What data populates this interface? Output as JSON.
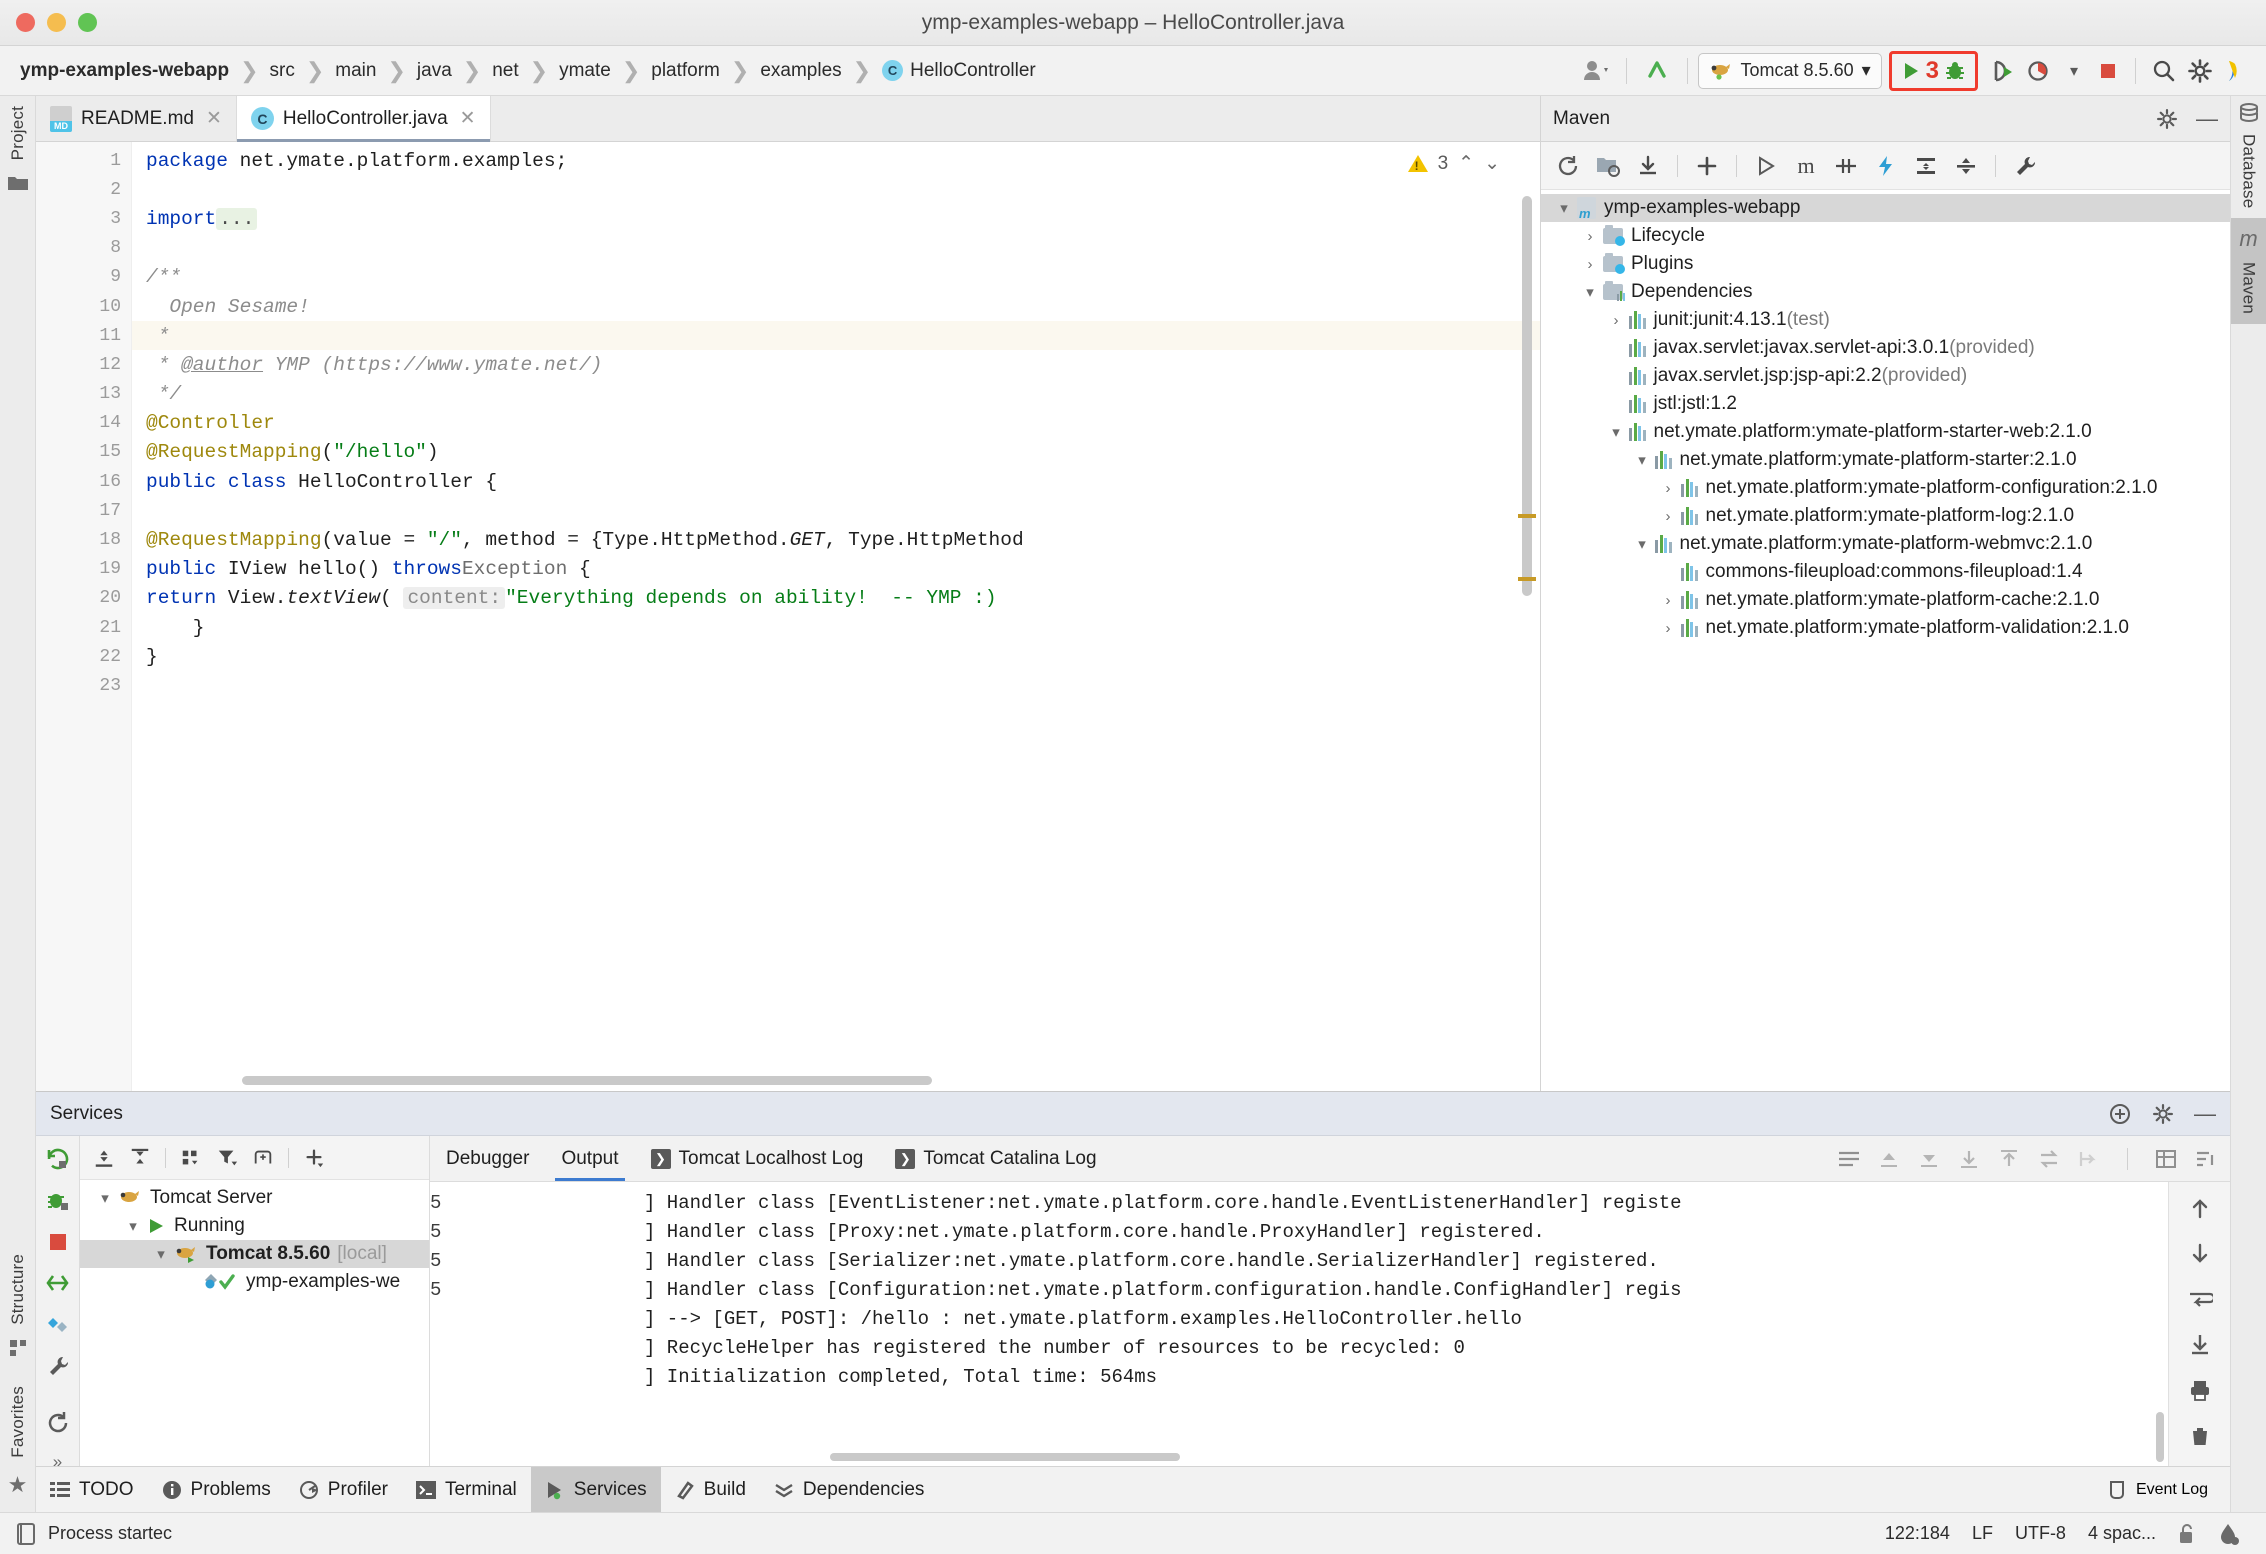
{
  "window": {
    "title": "ymp-examples-webapp – HelloController.java"
  },
  "breadcrumb": {
    "items": [
      {
        "label": "ymp-examples-webapp",
        "icon": null
      },
      {
        "label": "src",
        "icon": null
      },
      {
        "label": "main",
        "icon": null
      },
      {
        "label": "java",
        "icon": null
      },
      {
        "label": "net",
        "icon": null
      },
      {
        "label": "ymate",
        "icon": null
      },
      {
        "label": "platform",
        "icon": null
      },
      {
        "label": "examples",
        "icon": null
      },
      {
        "label": "HelloController",
        "icon": "class-icon"
      }
    ]
  },
  "toolbar": {
    "user_icon": "user-icon",
    "updates_icon": "update-arrow-icon",
    "run_config": {
      "label": "Tomcat 8.5.60",
      "icon": "tomcat-icon",
      "chevron": "▾"
    },
    "highlighted": {
      "run_icon": "run-triangle-icon",
      "count": "3",
      "debug_icon": "debug-bug-icon"
    },
    "rerun_icon": "rerun-icon",
    "coverage_icon": "coverage-icon",
    "coverage_chevron": "▾",
    "stop_icon": "stop-square-icon",
    "search_icon": "search-icon",
    "settings_icon": "gear-icon",
    "ide_icon": "ide-logo-icon"
  },
  "left_rail": {
    "items": [
      {
        "label": "Project",
        "icon": "project-folder-icon"
      },
      {
        "label": "Structure",
        "icon": "structure-icon"
      },
      {
        "label": "Favorites",
        "icon": "star-icon"
      }
    ]
  },
  "right_rail": {
    "items": [
      {
        "label": "Database",
        "icon": "database-icon",
        "active": false
      },
      {
        "label": "Maven",
        "icon": "maven-m-icon",
        "active": true
      }
    ]
  },
  "editor": {
    "tabs": [
      {
        "label": "README.md",
        "icon": "markdown-file-icon",
        "active": false,
        "close": "✕"
      },
      {
        "label": "HelloController.java",
        "icon": "java-class-icon",
        "active": true,
        "close": "✕"
      }
    ],
    "warnings": {
      "count": "3",
      "icon": "warning-triangle-icon",
      "up": "⌃",
      "down": "⌄"
    },
    "line_numbers": [
      "1",
      "2",
      "3",
      "8",
      "9",
      "10",
      "11",
      "12",
      "13",
      "14",
      "15",
      "16",
      "17",
      "18",
      "19",
      "20",
      "21",
      "22",
      "23"
    ],
    "code": [
      {
        "num": "1",
        "html": "<span class=\"kw\">package</span> net.ymate.platform.examples;"
      },
      {
        "num": "2",
        "html": ""
      },
      {
        "num": "3",
        "html": "<span class=\"kw\">import</span> <span class=\"foldchip\">...</span>"
      },
      {
        "num": "8",
        "html": ""
      },
      {
        "num": "9",
        "html": "<span class=\"cmt\">/**</span>"
      },
      {
        "num": "10",
        "html": "<span class=\"cmt\">  Open Sesame!</span>"
      },
      {
        "num": "11",
        "html": "<span class=\"cmt\"> *</span>",
        "highlight": true
      },
      {
        "num": "12",
        "html": "<span class=\"cmt\"> * <u>@author</u> YMP (https://www.ymate.net/)</span>"
      },
      {
        "num": "13",
        "html": "<span class=\"cmt\"> */</span>"
      },
      {
        "num": "14",
        "html": "<span class=\"ann\">@Controller</span>"
      },
      {
        "num": "15",
        "html": "<span class=\"ann\">@RequestMapping</span>(<span class=\"str\">\"/hello\"</span>)"
      },
      {
        "num": "16",
        "html": "<span class=\"kw\">public class</span> HelloController {"
      },
      {
        "num": "17",
        "html": ""
      },
      {
        "num": "18",
        "html": "    <span class=\"ann\">@RequestMapping</span>(value = <span class=\"str\">\"/\"</span>, method = {Type.HttpMethod.<span class=\"ital\">GET</span>, Type.HttpMethod"
      },
      {
        "num": "19",
        "html": "    <span class=\"kw\">public</span> IView hello() <span class=\"kw\">throws</span> <span class=\"gray\">Exception</span> {"
      },
      {
        "num": "20",
        "html": "        <span class=\"kw\">return</span> View.<span class=\"ital\">textView</span>( <span class=\"hint\">content:</span> <span class=\"str\">\"Everything depends on ability!  -- YMP :)</span>"
      },
      {
        "num": "21",
        "html": "    }"
      },
      {
        "num": "22",
        "html": "}"
      },
      {
        "num": "23",
        "html": ""
      }
    ]
  },
  "maven": {
    "title": "Maven",
    "header_icons": [
      "gear-icon",
      "minimize-icon"
    ],
    "toolbar_icons": [
      "reload-all-icon",
      "generate-sources-icon",
      "download-sources-icon",
      "add-maven-project-icon",
      "run-icon",
      "execute-goal-icon",
      "toggle-skip-tests-icon",
      "toggle-offline-icon",
      "expand-all-icon",
      "collapse-all-icon",
      "settings-wrench-icon"
    ],
    "tree": [
      {
        "depth": 0,
        "label": "ymp-examples-webapp",
        "twisty": "▾",
        "icon": "maven-project-icon",
        "selected": true
      },
      {
        "depth": 1,
        "label": "Lifecycle",
        "twisty": "›",
        "icon": "phase-folder-icon"
      },
      {
        "depth": 1,
        "label": "Plugins",
        "twisty": "›",
        "icon": "plugin-folder-icon"
      },
      {
        "depth": 1,
        "label": "Dependencies",
        "twisty": "▾",
        "icon": "dependency-folder-icon"
      },
      {
        "depth": 2,
        "label": "junit:junit:4.13.1",
        "scope": "(test)",
        "twisty": "›",
        "icon": "dependency-icon"
      },
      {
        "depth": 2,
        "label": "javax.servlet:javax.servlet-api:3.0.1",
        "scope": "(provided)",
        "twisty": "",
        "icon": "dependency-icon"
      },
      {
        "depth": 2,
        "label": "javax.servlet.jsp:jsp-api:2.2",
        "scope": "(provided)",
        "twisty": "",
        "icon": "dependency-icon"
      },
      {
        "depth": 2,
        "label": "jstl:jstl:1.2",
        "scope": "",
        "twisty": "",
        "icon": "dependency-icon"
      },
      {
        "depth": 2,
        "label": "net.ymate.platform:ymate-platform-starter-web:2.1.0",
        "scope": "",
        "twisty": "▾",
        "icon": "dependency-icon"
      },
      {
        "depth": 3,
        "label": "net.ymate.platform:ymate-platform-starter:2.1.0",
        "scope": "",
        "twisty": "▾",
        "icon": "dependency-icon"
      },
      {
        "depth": 4,
        "label": "net.ymate.platform:ymate-platform-configuration:2.1.0",
        "scope": "",
        "twisty": "›",
        "icon": "dependency-icon"
      },
      {
        "depth": 4,
        "label": "net.ymate.platform:ymate-platform-log:2.1.0",
        "scope": "",
        "twisty": "›",
        "icon": "dependency-icon"
      },
      {
        "depth": 3,
        "label": "net.ymate.platform:ymate-platform-webmvc:2.1.0",
        "scope": "",
        "twisty": "▾",
        "icon": "dependency-icon"
      },
      {
        "depth": 4,
        "label": "commons-fileupload:commons-fileupload:1.4",
        "scope": "",
        "twisty": "",
        "icon": "dependency-icon"
      },
      {
        "depth": 4,
        "label": "net.ymate.platform:ymate-platform-cache:2.1.0",
        "scope": "",
        "twisty": "›",
        "icon": "dependency-icon"
      },
      {
        "depth": 4,
        "label": "net.ymate.platform:ymate-platform-validation:2.1.0",
        "scope": "",
        "twisty": "›",
        "icon": "dependency-icon"
      }
    ]
  },
  "services": {
    "title": "Services",
    "header_icons": [
      "add-service-icon",
      "gear-icon",
      "minimize-icon"
    ],
    "rail_icons": [
      "rerun-icon",
      "debug-rerun-icon",
      "stop-icon",
      "redeploy-icon",
      "deployment-icon",
      "configure-icon",
      "refresh-icon"
    ],
    "toolbar_icons": [
      "expand-all-icon",
      "collapse-all-icon",
      "group-by-icon",
      "filter-icon",
      "show-hide-icon",
      "add-icon"
    ],
    "tree": [
      {
        "depth": 0,
        "label": "Tomcat Server",
        "twisty": "▾",
        "icon": "tomcat-icon",
        "bold": false
      },
      {
        "depth": 1,
        "label": "Running",
        "twisty": "▾",
        "icon": "run-triangle-icon",
        "bold": false
      },
      {
        "depth": 2,
        "label": "Tomcat 8.5.60",
        "suffix": "[local]",
        "twisty": "▾",
        "icon": "tomcat-running-icon",
        "bold": true,
        "selected": true
      },
      {
        "depth": 3,
        "label": "ymp-examples-we",
        "twisty": "",
        "icon": "artifact-deployed-icon",
        "bold": false
      }
    ],
    "console": {
      "tabs": [
        {
          "label": "Debugger",
          "icon": null,
          "active": false
        },
        {
          "label": "Output",
          "icon": null,
          "active": true
        },
        {
          "label": "Tomcat Localhost Log",
          "icon": "console-icon",
          "active": false
        },
        {
          "label": "Tomcat Catalina Log",
          "icon": "console-icon",
          "active": false
        }
      ],
      "tool_icons": [
        "soft-wrap-icon",
        "scroll-up-icon",
        "scroll-down-icon",
        "download-icon",
        "upload-icon",
        "swap-icon",
        "exit-icon",
        "print-table-icon",
        "clear-icon"
      ],
      "lines": [
        {
          "gutter": "5",
          "text": "] Handler class [EventListener:net.ymate.platform.core.handle.EventListenerHandler] registe",
          "clipped": true
        },
        {
          "gutter": "5",
          "text": "] Handler class [Proxy:net.ymate.platform.core.handle.ProxyHandler] registered."
        },
        {
          "gutter": "5",
          "text": "] Handler class [Serializer:net.ymate.platform.core.handle.SerializerHandler] registered."
        },
        {
          "gutter": "5",
          "text": "] Handler class [Configuration:net.ymate.platform.configuration.handle.ConfigHandler] regis",
          "clipped": true
        },
        {
          "gutter": "",
          "text": "] --> [GET, POST]: /hello : net.ymate.platform.examples.HelloController.hello"
        },
        {
          "gutter": "",
          "text": "] RecycleHelper has registered the number of resources to be recycled: 0"
        },
        {
          "gutter": "",
          "text": "] Initialization completed, Total time: 564ms"
        }
      ],
      "side_icons": [
        "scroll-to-top-icon",
        "scroll-to-bottom-icon",
        "soft-wrap-icon",
        "scroll-end-icon",
        "print-icon",
        "trash-icon"
      ]
    }
  },
  "bottom_tabs": {
    "items": [
      {
        "label": "TODO",
        "icon": "todo-list-icon",
        "active": false
      },
      {
        "label": "Problems",
        "icon": "problems-icon",
        "active": false
      },
      {
        "label": "Profiler",
        "icon": "profiler-icon",
        "active": false
      },
      {
        "label": "Terminal",
        "icon": "terminal-icon",
        "active": false
      },
      {
        "label": "Services",
        "icon": "services-icon",
        "active": true
      },
      {
        "label": "Build",
        "icon": "build-hammer-icon",
        "active": false
      },
      {
        "label": "Dependencies",
        "icon": "dependencies-icon",
        "active": false
      }
    ],
    "event_log": {
      "label": "Event Log",
      "icon": "event-log-icon"
    }
  },
  "status_bar": {
    "message": "Process startec",
    "message_icon": "console-small-icon",
    "caret": "122:184",
    "line_separator": "LF",
    "encoding": "UTF-8",
    "indent": "4 spac...",
    "lock_icon": "unlocked-icon",
    "inspection_icon": "inspection-drop-icon"
  },
  "colors": {
    "accent_blue": "#3d7bd0",
    "highlight_red": "#f03b2d",
    "run_green": "#3f9c35",
    "warning_yellow": "#f3c300",
    "keyword_blue": "#0033b3",
    "string_green": "#067d17",
    "annotation_gold": "#9e880d"
  }
}
